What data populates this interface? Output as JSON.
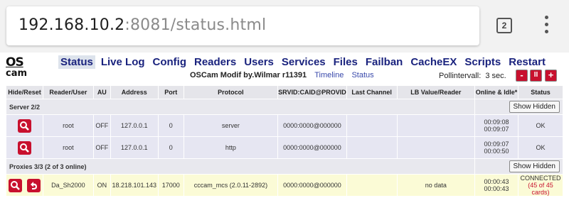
{
  "browser": {
    "url_host": "192.168.10.2",
    "url_rest": ":8081/status.html",
    "tab_count": "2"
  },
  "app": {
    "logo_top": "OS",
    "logo_bottom": "cam",
    "nav": [
      "Status",
      "Live Log",
      "Config",
      "Readers",
      "Users",
      "Services",
      "Files",
      "Failban",
      "CacheEX",
      "Scripts",
      "Restart"
    ],
    "version": "OSCam Modif by.Wilmar r11391",
    "timeline_link": "Timeline",
    "status_link": "Status",
    "poll_label": "Pollintervall:",
    "poll_value": "3",
    "poll_unit": "sec.",
    "poll_buttons": [
      "-",
      "II",
      "+"
    ]
  },
  "table": {
    "headers": [
      "Hide/Reset",
      "Reader/User",
      "AU",
      "Address",
      "Port",
      "Protocol",
      "SRVID:CAID@PROVID",
      "Last Channel",
      "LB Value/Reader",
      "Online & Idle*",
      "Status"
    ],
    "server_section": "Server 2/2",
    "show_hidden": "Show Hidden",
    "servers": [
      {
        "user": "root",
        "au": "OFF",
        "address": "127.0.0.1",
        "port": "0",
        "protocol": "server",
        "srvid": "0000:0000@000000",
        "last_channel": "",
        "lb": "",
        "online": "00:09:08",
        "idle": "00:09:07",
        "status": "OK"
      },
      {
        "user": "root",
        "au": "OFF",
        "address": "127.0.0.1",
        "port": "0",
        "protocol": "http",
        "srvid": "0000:0000@000000",
        "last_channel": "",
        "lb": "",
        "online": "00:09:07",
        "idle": "00:00:50",
        "status": "OK"
      }
    ],
    "proxy_section": "Proxies 3/3 (2 of 3 online)",
    "proxies": [
      {
        "user": "Da_Sh2000",
        "au": "ON",
        "address": "18.218.101.143",
        "port": "17000",
        "protocol": "cccam_mcs (2.0.11-2892)",
        "srvid": "0000:0000@000000",
        "last_channel": "",
        "lb": "no data",
        "online": "00:00:43",
        "idle": "00:00:43",
        "status": "CONNECTED",
        "status_note": "(45 of 45 cards)"
      }
    ]
  },
  "colors": {
    "nav_blue": "#1a237e",
    "button_red": "#c8102e",
    "proxy_row": "#fbfbd6",
    "server_row": "#e6e6f2"
  }
}
